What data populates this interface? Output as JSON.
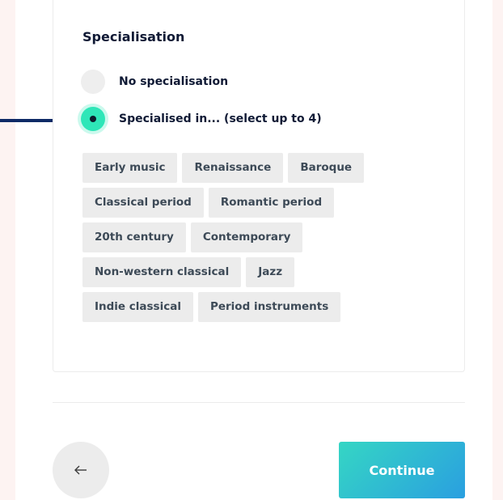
{
  "section": {
    "title": "Specialisation"
  },
  "options": [
    {
      "label": "No specialisation",
      "selected": false
    },
    {
      "label": "Specialised in... (select up to 4)",
      "selected": true
    }
  ],
  "tag_rows": [
    [
      "Early music",
      "Renaissance",
      "Baroque"
    ],
    [
      "Classical period",
      "Romantic period"
    ],
    [
      "20th century",
      "Contemporary"
    ],
    [
      "Non-western classical",
      "Jazz"
    ],
    [
      "Indie classical",
      "Period instruments"
    ]
  ],
  "footer": {
    "continue_label": "Continue",
    "back_icon": "arrow-left-icon"
  },
  "colors": {
    "accent": "#2ee6b8",
    "gradient_start": "#35d6c4",
    "gradient_end": "#2a9fe0",
    "pointer": "#0e2a66"
  }
}
